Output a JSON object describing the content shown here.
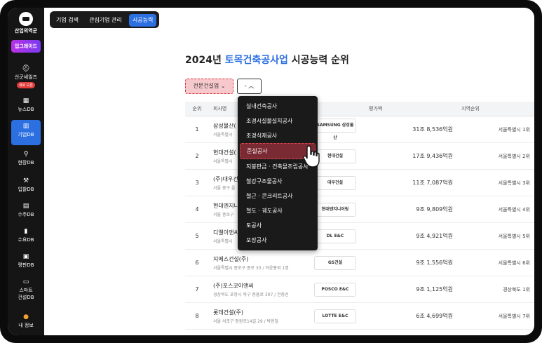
{
  "sidebar": {
    "brand": "산업의역군",
    "upgrade": "업그레이드",
    "items": [
      {
        "label": "산군세일즈",
        "badge": "새로 오픈"
      },
      {
        "label": "뉴스DB"
      },
      {
        "label": "기업DB",
        "active": true
      },
      {
        "label": "현장DB"
      },
      {
        "label": "입찰DB"
      },
      {
        "label": "수주DB"
      },
      {
        "label": "수요DB"
      },
      {
        "label": "평판DB"
      },
      {
        "label": "스마트",
        "label2": "건설DB"
      },
      {
        "label": "내 정보"
      }
    ]
  },
  "tabs": [
    "기업 검색",
    "관심기업 관리",
    "시공능력"
  ],
  "title": {
    "year": "2024년",
    "highlight": "토목건축공사업",
    "rest": "시공능력 순위"
  },
  "filters": {
    "category": "전문건설업",
    "sub": "-"
  },
  "table": {
    "headers": [
      "순위",
      "회사명",
      "",
      "평가액",
      "지역순위"
    ],
    "rows": [
      {
        "rank": "1",
        "name": "삼성물산(",
        "addr": "서울특별시",
        "logo": "SAMSUNG 삼성물산",
        "amount": "31조 8,536억원",
        "region": "서울특별시 1위"
      },
      {
        "rank": "2",
        "name": "현대건설(",
        "addr": "서울특별시",
        "logo": "현대건설",
        "amount": "17조 9,436억원",
        "region": "서울특별시 2위"
      },
      {
        "rank": "3",
        "name": "(주)대우건",
        "addr": "서울 중구 을",
        "logo": "대우건설",
        "amount": "11조 7,087억원",
        "region": "서울특별시 3위"
      },
      {
        "rank": "4",
        "name": "현대엔지니",
        "addr": "서울 종로구",
        "logo": "현대엔지니어링",
        "amount": "9조 9,809억원",
        "region": "서울특별시 4위"
      },
      {
        "rank": "5",
        "name": "디엘이앤씨",
        "addr": "서울특별시",
        "logo": "DL E&C",
        "amount": "9조 4,921억원",
        "region": "서울특별시 5위"
      },
      {
        "rank": "6",
        "name": "지에스건설(주)",
        "addr": "서울특별시 종로구 종로 33 / 허윤홍외 1명",
        "logo": "GS건설",
        "amount": "9조 1,556억원",
        "region": "서울특별시 6위"
      },
      {
        "rank": "7",
        "name": "(주)포스코이앤씨",
        "addr": "경상북도 포항시 북구 중흥로 307 / 전중선",
        "logo": "POSCO E&C",
        "amount": "9조 1,125억원",
        "region": "경상북도 1위"
      },
      {
        "rank": "8",
        "name": "롯데건설(주)",
        "addr": "서울 서초구 잠원로14길 29 / 박현철",
        "logo": "LOTTE E&C",
        "amount": "6조 4,699억원",
        "region": "서울특별시 7위"
      }
    ]
  },
  "dropdown": {
    "items": [
      "실내건축공사",
      "조경시설물설치공사",
      "조경식재공사",
      "준설공사",
      "지붕판금 · 건축물조립공사",
      "철강구조물공사",
      "철근 · 콘크리트공사",
      "철도 · 궤도공사",
      "토공사",
      "포장공사"
    ],
    "hovered": "준설공사"
  }
}
